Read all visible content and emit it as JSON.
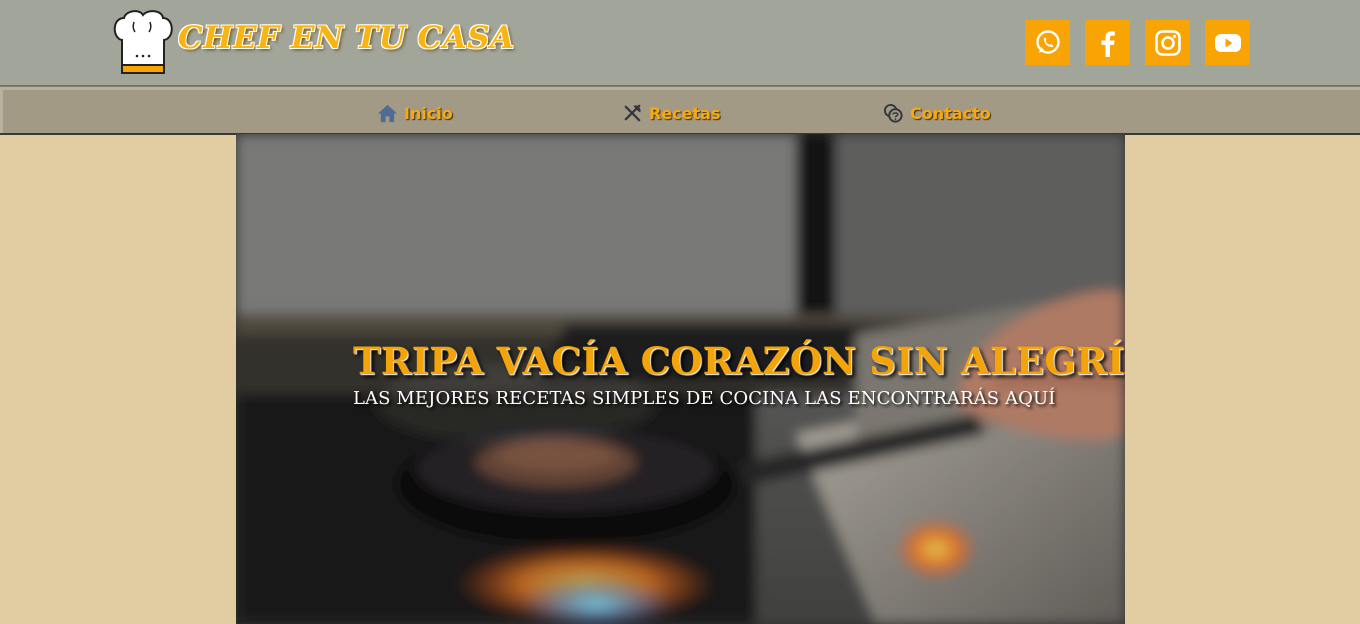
{
  "header": {
    "brand_name": "CHEF EN TU CASA",
    "logo_icon": "chef-hat-icon",
    "social": [
      {
        "name": "whatsapp",
        "icon": "whatsapp-icon"
      },
      {
        "name": "facebook",
        "icon": "facebook-icon"
      },
      {
        "name": "instagram",
        "icon": "instagram-icon"
      },
      {
        "name": "youtube",
        "icon": "youtube-icon"
      }
    ]
  },
  "nav": {
    "items": [
      {
        "label": "Inicio",
        "icon": "home-icon"
      },
      {
        "label": "Recetas",
        "icon": "utensils-icon"
      },
      {
        "label": "Contacto",
        "icon": "contact-chat-icon"
      }
    ]
  },
  "hero": {
    "title": "TRIPA VACÍA CORAZÓN SIN ALEGRÍA",
    "subtitle": "LAS MEJORES RECETAS SIMPLES DE COCINA LAS ENCONTRARÁS AQUÍ"
  },
  "colors": {
    "header_bg": "#a2a59a",
    "nav_bg": "#a39a86",
    "page_bg": "#e2cda2",
    "accent": "#f8a404"
  }
}
